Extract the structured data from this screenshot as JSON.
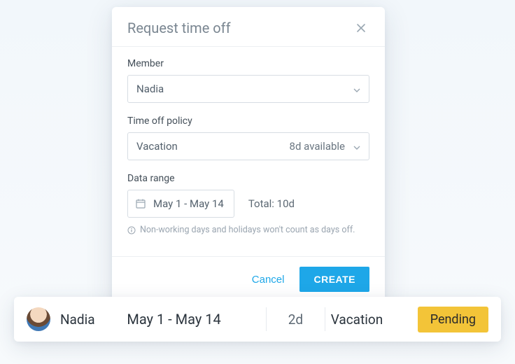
{
  "modal": {
    "title": "Request time off",
    "member": {
      "label": "Member",
      "value": "Nadia"
    },
    "policy": {
      "label": "Time off policy",
      "value": "Vacation",
      "available": "8d available"
    },
    "range": {
      "label": "Data range",
      "value": "May 1 - May 14",
      "total": "Total: 10d"
    },
    "note": "Non-working days and holidays won't count as days off.",
    "actions": {
      "cancel": "Cancel",
      "create": "CREATE"
    }
  },
  "row": {
    "name": "Nadia",
    "range": "May 1 - May 14",
    "days": "2d",
    "policy": "Vacation",
    "status": "Pending"
  }
}
